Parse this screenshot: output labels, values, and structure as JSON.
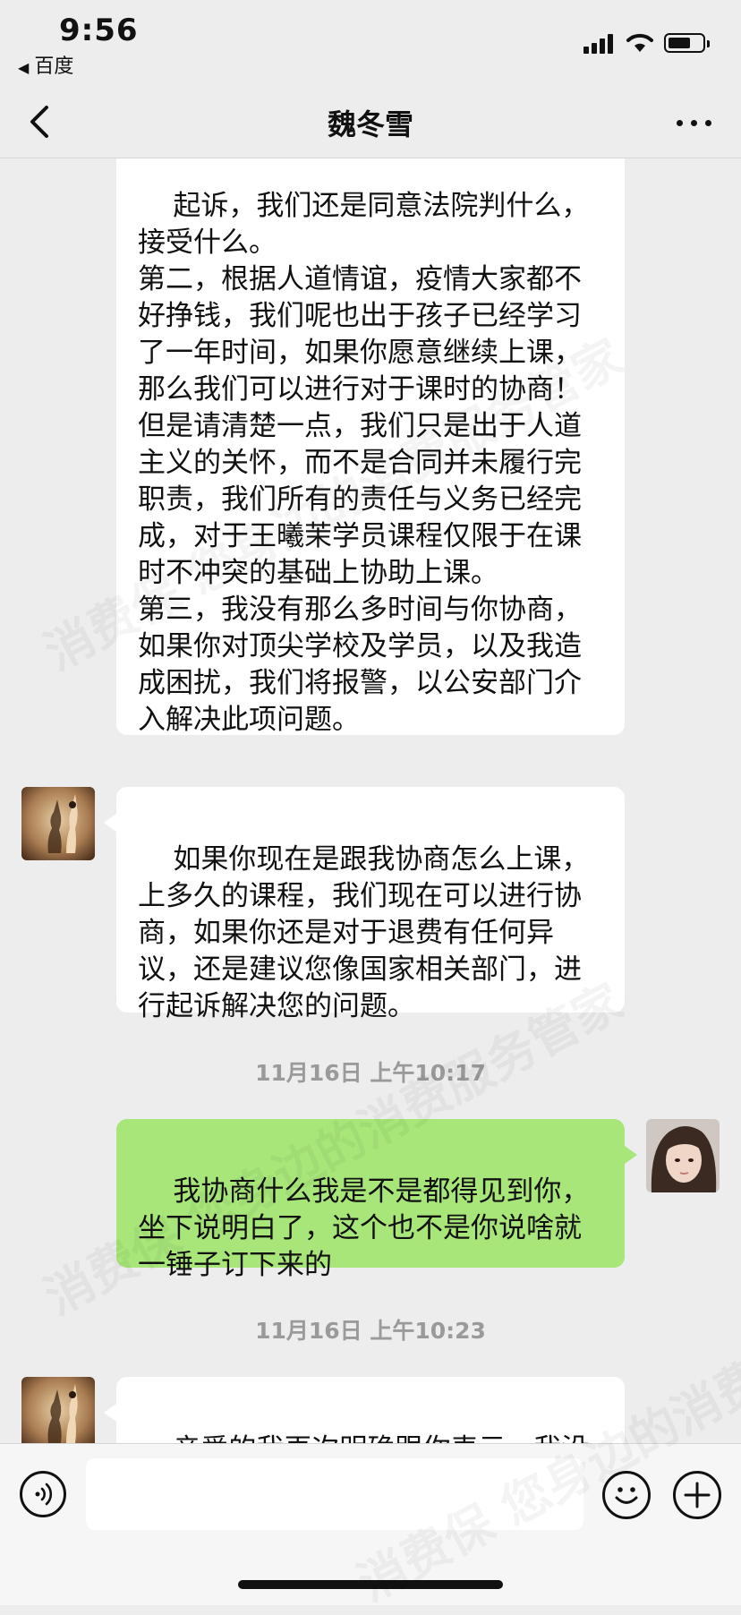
{
  "status_bar": {
    "time": "9:56",
    "back_app_label": "百度",
    "icons": [
      "signal-icon",
      "wifi-icon",
      "battery-icon"
    ]
  },
  "nav": {
    "title": "魏冬雪",
    "back_icon": "chevron-left-icon",
    "more_icon": "ellipsis-icon"
  },
  "messages": [
    {
      "sender": "contact",
      "text": "起诉，我们还是同意法院判什么，\n接受什么。\n第二，根据人道情谊，疫情大家都不好挣钱，我们呢也出于孩子已经学习了一年时间，如果你愿意继续上课，那么我们可以进行对于课时的协商！但是请清楚一点，我们只是出于人道主义的关怀，而不是合同并未履行完职责，我们所有的责任与义务已经完成，对于王曦茉学员课程仅限于在课时不冲突的基础上协助上课。\n第三，我没有那么多时间与你协商，如果你对顶尖学校及学员，以及我造成困扰，我们将报警，以公安部门介入解决此项问题。"
    },
    {
      "sender": "contact",
      "text": "如果你现在是跟我协商怎么上课，上多久的课程，我们现在可以进行协商，如果你还是对于退费有任何异议，还是建议您像国家相关部门，进行起诉解决您的问题。"
    },
    {
      "timestamp": "11月16日 上午10:17"
    },
    {
      "sender": "me",
      "text": "我协商什么我是不是都得见到你，坐下说明白了，这个也不是你说啥就一锤子订下来的"
    },
    {
      "timestamp": "11月16日 上午10:23"
    },
    {
      "sender": "contact",
      "text": "亲爱的我再次明确跟你表示，我没"
    }
  ],
  "watermark_text": "消费保 您身边的消费服务管家",
  "input_bar": {
    "placeholder": "",
    "voice_icon": "voice-icon",
    "emoji_icon": "emoji-icon",
    "plus_icon": "plus-icon"
  }
}
